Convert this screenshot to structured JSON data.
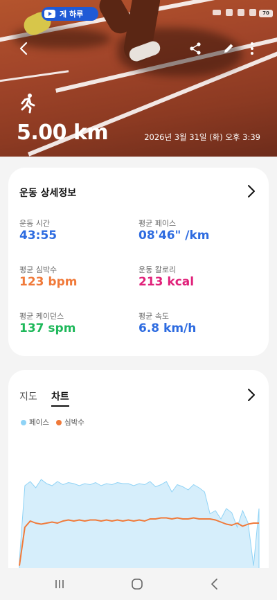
{
  "hero": {
    "distance": "5.00 km",
    "datetime": "2026년 3월 31일 (화) 오후 3:39",
    "back_icon": "chevron-left-icon",
    "share_icon": "share-icon",
    "edit_icon": "pencil-icon",
    "more_icon": "more-vertical-icon",
    "activity_icon": "running-icon"
  },
  "statusbar": {
    "media_pill": "게 하루"
  },
  "details": {
    "title": "운동 상세정보",
    "metrics": [
      {
        "label": "운동 시간",
        "value": "43:55",
        "color": "#2d6be0"
      },
      {
        "label": "평균 페이스",
        "value": "08'46\" /km",
        "color": "#2d6be0"
      },
      {
        "label": "평균 심박수",
        "value": "123 bpm",
        "color": "#f07a3a"
      },
      {
        "label": "운동 칼로리",
        "value": "213 kcal",
        "color": "#e0217a"
      },
      {
        "label": "평균 케이던스",
        "value": "137 spm",
        "color": "#1eb85a"
      },
      {
        "label": "평균 속도",
        "value": "6.8 km/h",
        "color": "#2d6be0"
      }
    ]
  },
  "chart_card": {
    "tab_map": "지도",
    "tab_chart": "차트",
    "legend_pace": "페이스",
    "legend_hr": "심박수",
    "pace_color": "#8fd3f6",
    "hr_color": "#f07a3a"
  },
  "chart_data": {
    "type": "line",
    "title": "",
    "series": [
      {
        "name": "페이스",
        "color": "#8fd3f6",
        "values": [
          0.1,
          0.82,
          0.86,
          0.8,
          0.88,
          0.84,
          0.82,
          0.86,
          0.83,
          0.85,
          0.84,
          0.82,
          0.84,
          0.83,
          0.85,
          0.82,
          0.84,
          0.83,
          0.85,
          0.84,
          0.84,
          0.82,
          0.84,
          0.83,
          0.86,
          0.81,
          0.83,
          0.86,
          0.76,
          0.83,
          0.81,
          0.78,
          0.83,
          0.8,
          0.76,
          0.55,
          0.58,
          0.5,
          0.6,
          0.56,
          0.42,
          0.58,
          0.46,
          0.05,
          0.6
        ]
      },
      {
        "name": "심박수",
        "color": "#f07a3a",
        "values": [
          0.05,
          0.42,
          0.48,
          0.46,
          0.45,
          0.46,
          0.47,
          0.46,
          0.48,
          0.49,
          0.48,
          0.49,
          0.48,
          0.49,
          0.49,
          0.48,
          0.49,
          0.48,
          0.49,
          0.48,
          0.49,
          0.48,
          0.49,
          0.48,
          0.5,
          0.5,
          0.51,
          0.51,
          0.5,
          0.51,
          0.5,
          0.5,
          0.51,
          0.5,
          0.5,
          0.5,
          0.49,
          0.47,
          0.45,
          0.44,
          0.46,
          0.43,
          0.45,
          0.46,
          0.46
        ]
      }
    ]
  }
}
